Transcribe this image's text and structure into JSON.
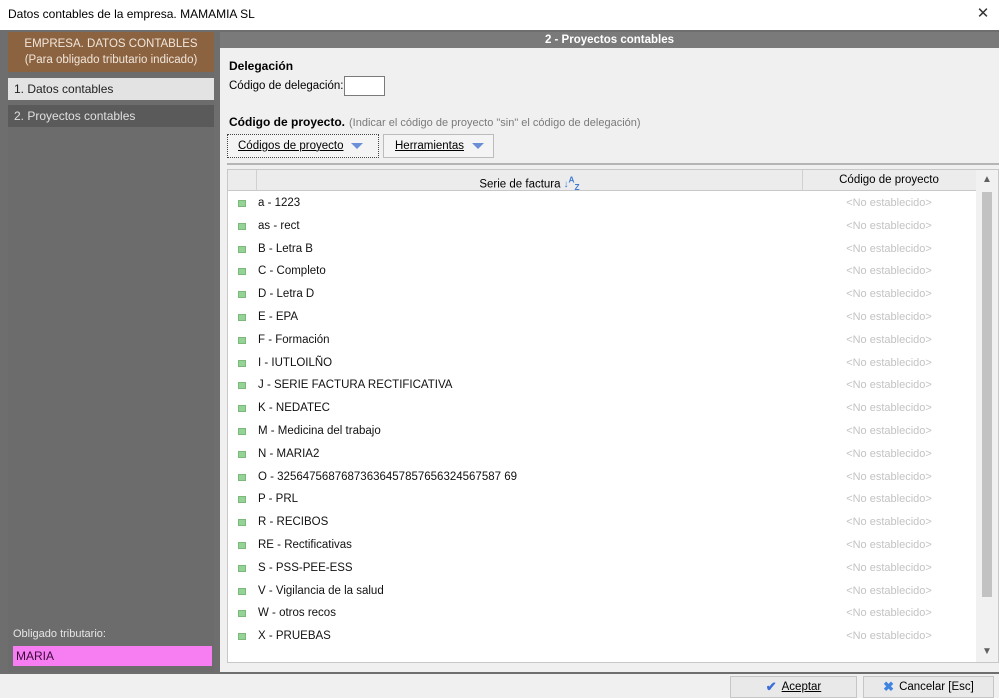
{
  "window": {
    "title": "Datos contables de la empresa. MAMAMIA SL",
    "close_glyph": "✕"
  },
  "sidebar": {
    "header_line1": "EMPRESA. DATOS CONTABLES",
    "header_line2": "(Para obligado tributario indicado)",
    "items": [
      {
        "label": "1. Datos contables"
      },
      {
        "label": "2. Proyectos contables"
      }
    ],
    "obligado_label": "Obligado tributario:",
    "obligado_value": "MARIA"
  },
  "main": {
    "header": "2 - Proyectos contables",
    "delegacion_title": "Delegación",
    "codigo_delegacion_label": "Código de delegación:",
    "codigo_delegacion_value": "",
    "proyecto_title": "Código de proyecto.",
    "proyecto_note": "(Indicar el código de proyecto \"sin\" el código de delegación)",
    "toolbar": {
      "codigos_label": "Códigos de proyecto",
      "herramientas_label": "Herramientas"
    },
    "grid": {
      "col_serie": "Serie de factura",
      "col_serie_sort_icon": "sort-az-icon",
      "col_code": "Código de proyecto",
      "rows": [
        {
          "serie": "a - 1223",
          "code": "<No establecido>"
        },
        {
          "serie": "as - rect",
          "code": "<No establecido>"
        },
        {
          "serie": "B - Letra B",
          "code": "<No establecido>"
        },
        {
          "serie": "C - Completo",
          "code": "<No establecido>"
        },
        {
          "serie": "D - Letra D",
          "code": "<No establecido>"
        },
        {
          "serie": "E - EPA",
          "code": "<No establecido>"
        },
        {
          "serie": "F - Formación",
          "code": "<No establecido>"
        },
        {
          "serie": "I - IUTLOILÑO",
          "code": "<No establecido>"
        },
        {
          "serie": "J - SERIE FACTURA RECTIFICATIVA",
          "code": "<No establecido>"
        },
        {
          "serie": "K - NEDATEC",
          "code": "<No establecido>"
        },
        {
          "serie": "M - Medicina del trabajo",
          "code": "<No establecido>"
        },
        {
          "serie": "N - MARIA2",
          "code": "<No establecido>"
        },
        {
          "serie": "O - 32564756876873636457857656324567587 69",
          "code": "<No establecido>"
        },
        {
          "serie": "P - PRL",
          "code": "<No establecido>"
        },
        {
          "serie": "R - RECIBOS",
          "code": "<No establecido>"
        },
        {
          "serie": "RE - Rectificativas",
          "code": "<No establecido>"
        },
        {
          "serie": "S - PSS-PEE-ESS",
          "code": "<No establecido>"
        },
        {
          "serie": "V - Vigilancia de la salud",
          "code": "<No establecido>"
        },
        {
          "serie": "W - otros recos",
          "code": "<No establecido>"
        },
        {
          "serie": "X - PRUEBAS",
          "code": "<No establecido>"
        }
      ]
    }
  },
  "footer": {
    "aceptar_label": "Aceptar",
    "cancelar_label": "Cancelar [Esc]"
  },
  "colors": {
    "sidebar_header": "#8b6340",
    "obligado_highlight": "#f77ef2",
    "row_marker": "#95d295",
    "toolbar_arrow": "#6b8fd6"
  }
}
